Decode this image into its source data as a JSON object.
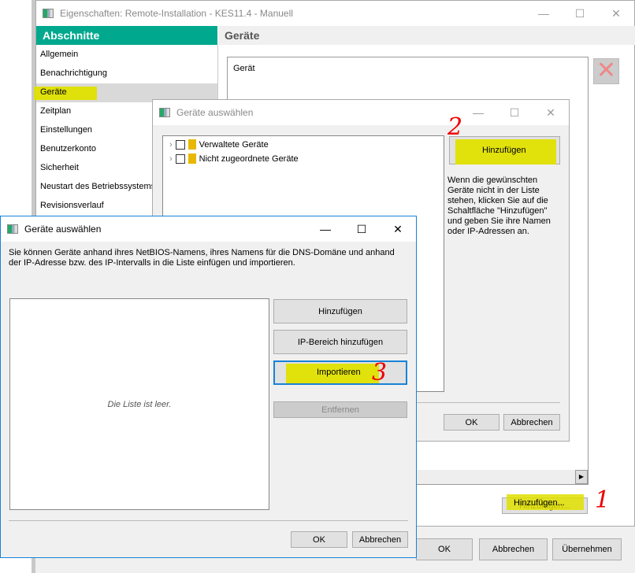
{
  "main": {
    "title": "Eigenschaften: Remote-Installation - KES11.4 - Manuell",
    "sidebar_header": "Abschnitte",
    "sidebar": [
      "Allgemein",
      "Benachrichtigung",
      "Geräte",
      "Zeitplan",
      "Einstellungen",
      "Benutzerkonto",
      "Sicherheit",
      "Neustart des Betriebssystems",
      "Revisionsverlauf"
    ],
    "section_title": "Geräte",
    "column_header": "Gerät",
    "add_button": "Hinzufügen...",
    "ok": "OK",
    "cancel": "Abbrechen",
    "apply": "Übernehmen"
  },
  "dialog2": {
    "title": "Geräte auswählen",
    "tree": [
      "Verwaltete Geräte",
      "Nicht zugeordnete Geräte"
    ],
    "add_button": "Hinzufügen",
    "hint": "Wenn die gewünschten Geräte nicht in der Liste stehen, klicken Sie auf die Schaltfläche \"Hinzufügen\" und geben Sie ihre Namen oder IP-Adressen an.",
    "ok": "OK",
    "cancel": "Abbrechen"
  },
  "dialog3": {
    "title": "Geräte auswählen",
    "description": "Sie können Geräte anhand ihres NetBIOS-Namens, ihres Namens für die DNS-Domäne und anhand der IP-Adresse bzw. des IP-Intervalls in die Liste einfügen und importieren.",
    "empty": "Die Liste ist leer.",
    "add": "Hinzufügen",
    "add_range": "IP-Bereich hinzufügen",
    "import": "Importieren",
    "remove": "Entfernen",
    "ok": "OK",
    "cancel": "Abbrechen"
  },
  "annotations": [
    "1",
    "2",
    "3"
  ],
  "colors": {
    "accent": "#00a88e",
    "highlight": "#e0e000",
    "annotation": "#e00000",
    "focus": "#1883d7"
  }
}
